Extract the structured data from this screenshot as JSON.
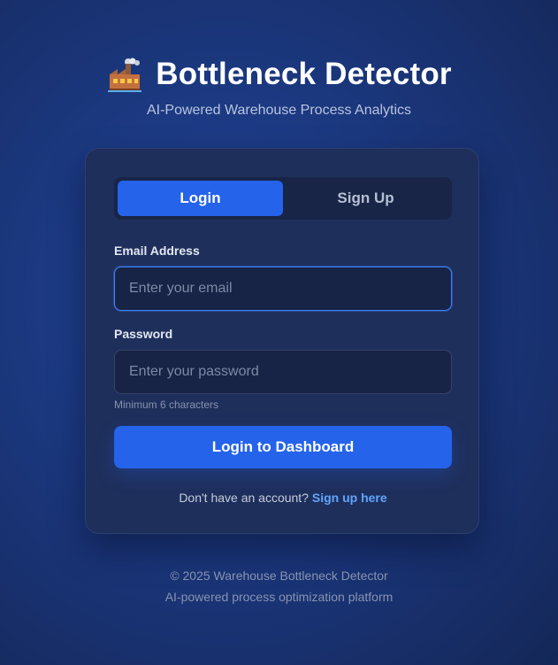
{
  "header": {
    "icon": "factory-icon",
    "title": "Bottleneck Detector",
    "subtitle": "AI-Powered Warehouse Process Analytics"
  },
  "tabs": {
    "login_label": "Login",
    "signup_label": "Sign Up",
    "active": "Login"
  },
  "form": {
    "email_label": "Email Address",
    "email_placeholder": "Enter your email",
    "email_value": "",
    "password_label": "Password",
    "password_placeholder": "Enter your password",
    "password_value": "",
    "password_hint": "Minimum 6 characters",
    "submit_label": "Login to Dashboard"
  },
  "switch": {
    "prompt": "Don't have an account?",
    "link_label": "Sign up here"
  },
  "footer": {
    "copyright": "© 2025 Warehouse Bottleneck Detector",
    "tagline": "AI-powered process optimization platform"
  },
  "colors": {
    "accent": "#2563eb",
    "link": "#60a5fa",
    "background": "#1c3a84",
    "card": "#1f2f5c"
  }
}
